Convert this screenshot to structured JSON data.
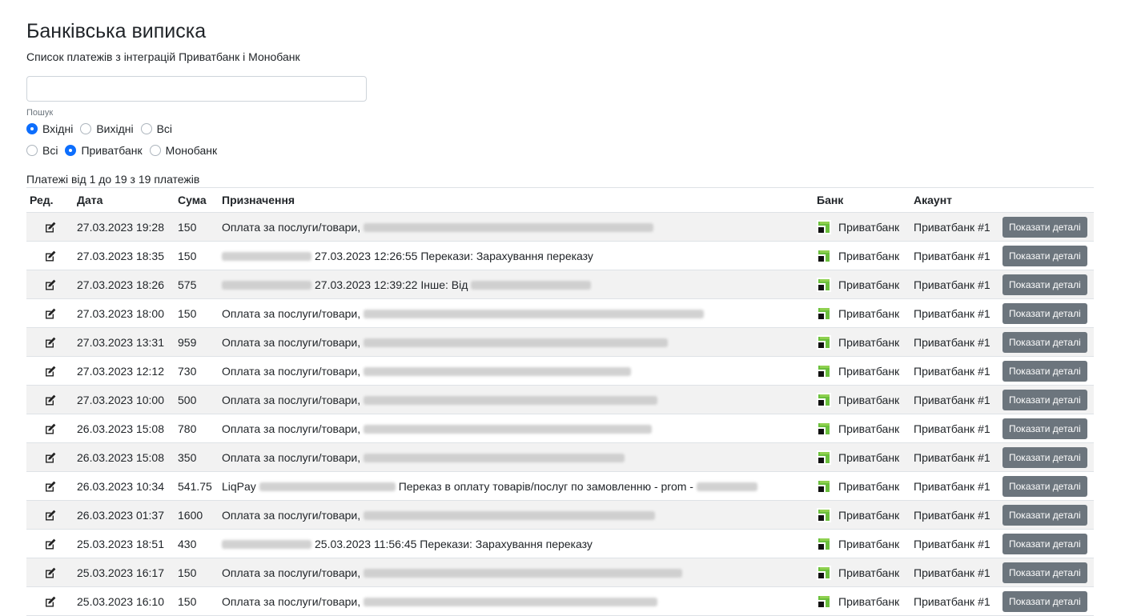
{
  "header": {
    "title": "Банківська виписка",
    "subtitle": "Список платежів з інтеграцій Приватбанк і Монобанк"
  },
  "search": {
    "value": "",
    "placeholder": "",
    "label": "Пошук"
  },
  "direction_filter": {
    "options": [
      {
        "label": "Вхідні",
        "checked": true
      },
      {
        "label": "Вихідні",
        "checked": false
      },
      {
        "label": "Всі",
        "checked": false
      }
    ]
  },
  "bank_filter": {
    "options": [
      {
        "label": "Всі",
        "checked": false
      },
      {
        "label": "Приватбанк",
        "checked": true
      },
      {
        "label": "Монобанк",
        "checked": false
      }
    ]
  },
  "summary": "Платежі від 1 до 19 з 19 платежів",
  "table": {
    "columns": [
      "Ред.",
      "Дата",
      "Сума",
      "Призначення",
      "Банк",
      "Акаунт",
      ""
    ],
    "detail_button_label": "Показати деталі",
    "rows": [
      {
        "date": "27.03.2023 19:28",
        "sum": "150",
        "purpose": "Оплата за послуги/товари,",
        "purpose_tail": "",
        "bank": "Приватбанк",
        "account": "Приватбанк #1"
      },
      {
        "date": "27.03.2023 18:35",
        "sum": "150",
        "purpose": "",
        "purpose_tail": "27.03.2023 12:26:55 Перекази: Зарахування переказу",
        "bank": "Приватбанк",
        "account": "Приватбанк #1"
      },
      {
        "date": "27.03.2023 18:26",
        "sum": "575",
        "purpose": "",
        "purpose_tail": "27.03.2023 12:39:22 Інше: Від",
        "bank": "Приватбанк",
        "account": "Приватбанк #1"
      },
      {
        "date": "27.03.2023 18:00",
        "sum": "150",
        "purpose": "Оплата за послуги/товари,",
        "purpose_tail": "",
        "bank": "Приватбанк",
        "account": "Приватбанк #1"
      },
      {
        "date": "27.03.2023 13:31",
        "sum": "959",
        "purpose": "Оплата за послуги/товари,",
        "purpose_tail": "",
        "bank": "Приватбанк",
        "account": "Приватбанк #1"
      },
      {
        "date": "27.03.2023 12:12",
        "sum": "730",
        "purpose": "Оплата за послуги/товари,",
        "purpose_tail": "",
        "bank": "Приватбанк",
        "account": "Приватбанк #1"
      },
      {
        "date": "27.03.2023 10:00",
        "sum": "500",
        "purpose": "Оплата за послуги/товари,",
        "purpose_tail": "",
        "bank": "Приватбанк",
        "account": "Приватбанк #1"
      },
      {
        "date": "26.03.2023 15:08",
        "sum": "780",
        "purpose": "Оплата за послуги/товари,",
        "purpose_tail": "",
        "bank": "Приватбанк",
        "account": "Приватбанк #1"
      },
      {
        "date": "26.03.2023 15:08",
        "sum": "350",
        "purpose": "Оплата за послуги/товари,",
        "purpose_tail": "",
        "bank": "Приватбанк",
        "account": "Приватбанк #1"
      },
      {
        "date": "26.03.2023 10:34",
        "sum": "541.75",
        "purpose": "LiqPay",
        "purpose_tail": "Переказ в оплату товарів/послуг по замовленню - prom -",
        "bank": "Приватбанк",
        "account": "Приватбанк #1"
      },
      {
        "date": "26.03.2023 01:37",
        "sum": "1600",
        "purpose": "Оплата за послуги/товари,",
        "purpose_tail": "",
        "bank": "Приватбанк",
        "account": "Приватбанк #1"
      },
      {
        "date": "25.03.2023 18:51",
        "sum": "430",
        "purpose": "",
        "purpose_tail": "25.03.2023 11:56:45 Перекази: Зарахування переказу",
        "bank": "Приватбанк",
        "account": "Приватбанк #1"
      },
      {
        "date": "25.03.2023 16:17",
        "sum": "150",
        "purpose": "Оплата за послуги/товари,",
        "purpose_tail": "",
        "bank": "Приватбанк",
        "account": "Приватбанк #1"
      },
      {
        "date": "25.03.2023 16:10",
        "sum": "150",
        "purpose": "Оплата за послуги/товари,",
        "purpose_tail": "",
        "bank": "Приватбанк",
        "account": "Приватбанк #1"
      }
    ]
  },
  "colors": {
    "radio_checked": "#0d6efd",
    "button_bg": "#6c757d",
    "row_stripe": "#f2f2f2",
    "privat_green": "#6abf3c"
  },
  "icons": {
    "edit": "edit-icon",
    "bank_logo": "privatbank-logo-icon"
  }
}
